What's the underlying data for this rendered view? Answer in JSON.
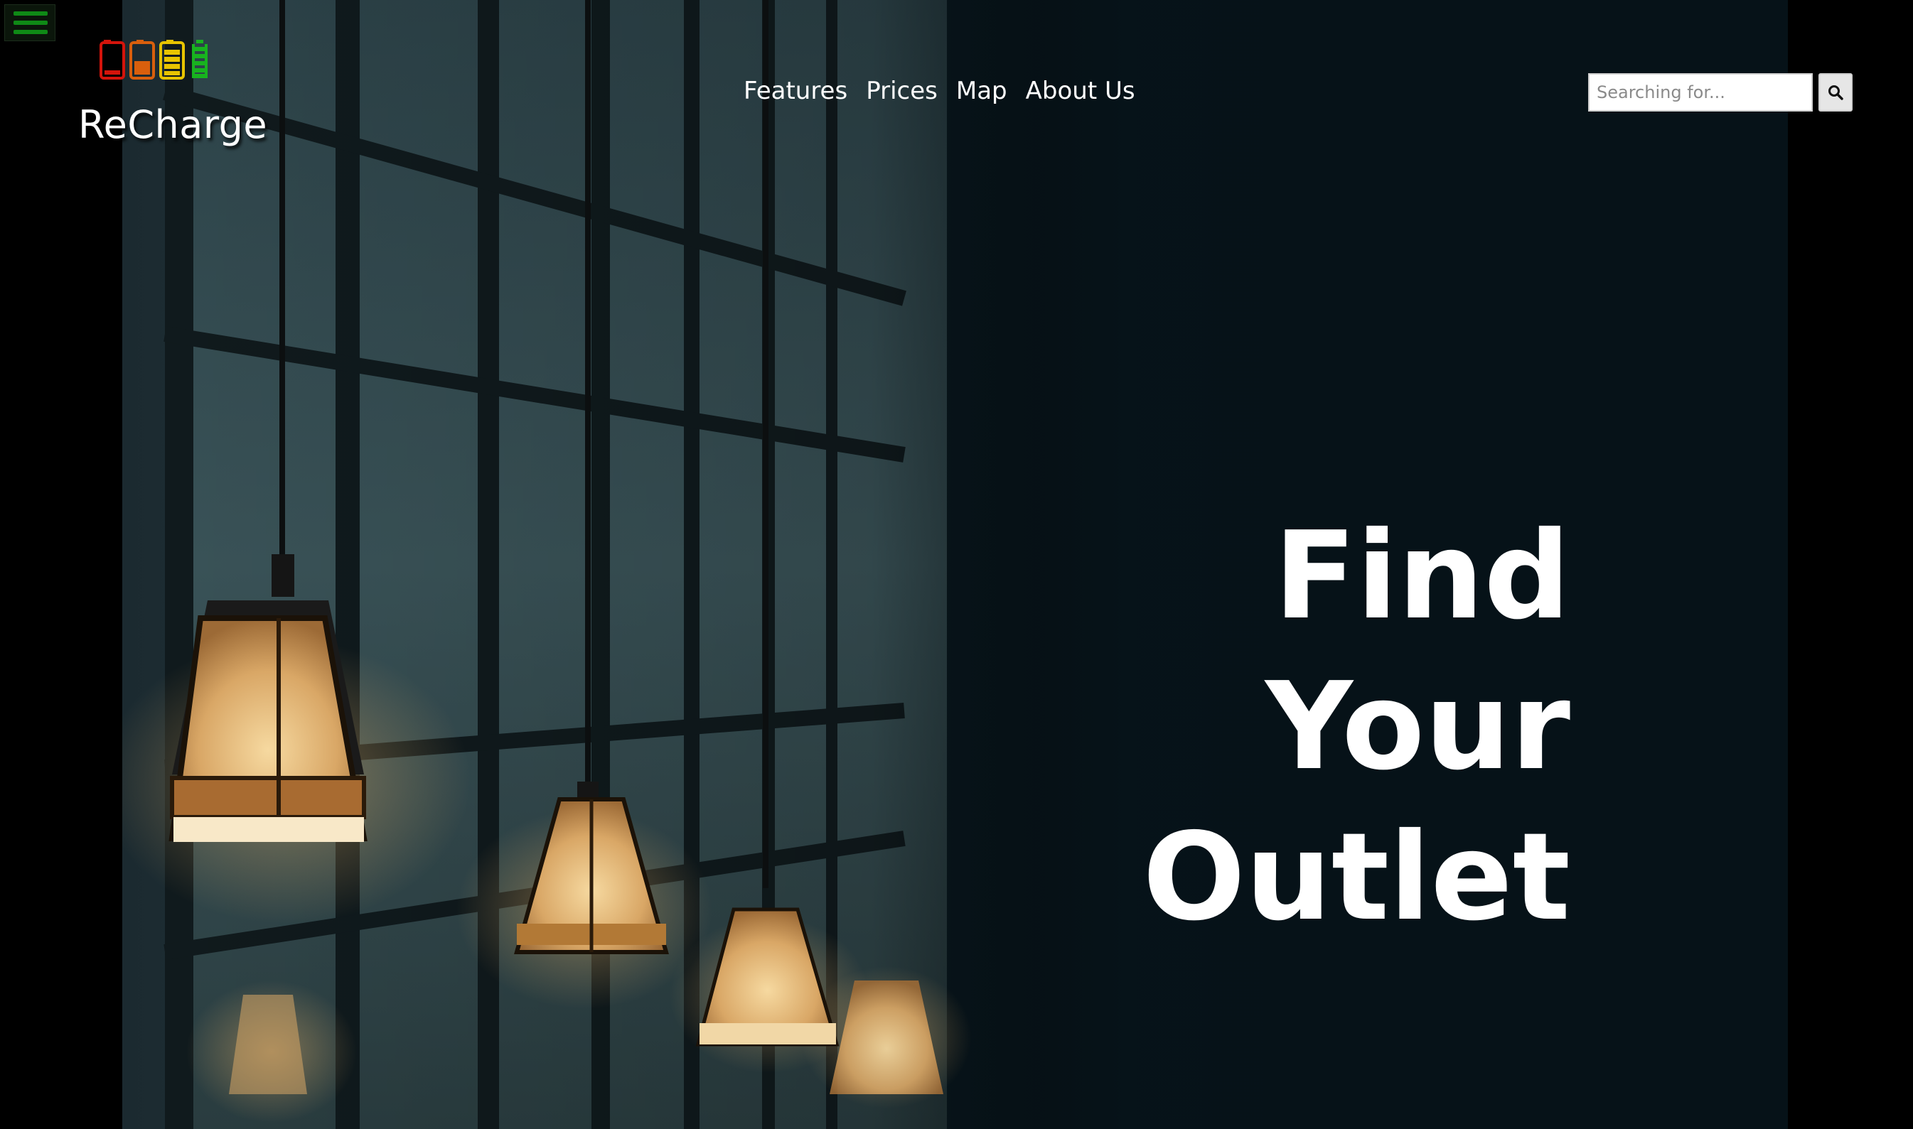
{
  "header": {
    "brand": "ReCharge",
    "menu_icon": "hamburger-menu-icon",
    "logo_icon": "battery-levels-icon",
    "battery_colors": [
      "#d4140b",
      "#d95f0d",
      "#e8c400",
      "#18b31f"
    ]
  },
  "nav": {
    "items": [
      {
        "label": "Features"
      },
      {
        "label": "Prices"
      },
      {
        "label": "Map"
      },
      {
        "label": "About Us"
      }
    ]
  },
  "search": {
    "placeholder": "Searching for...",
    "button_icon": "search-icon"
  },
  "hero": {
    "lines": [
      "Find",
      "Your",
      "Outlet"
    ],
    "image": "pendant-lamps-photo"
  },
  "colors": {
    "background": "#000000",
    "text": "#ffffff",
    "menu_accent": "#0f8a16"
  }
}
